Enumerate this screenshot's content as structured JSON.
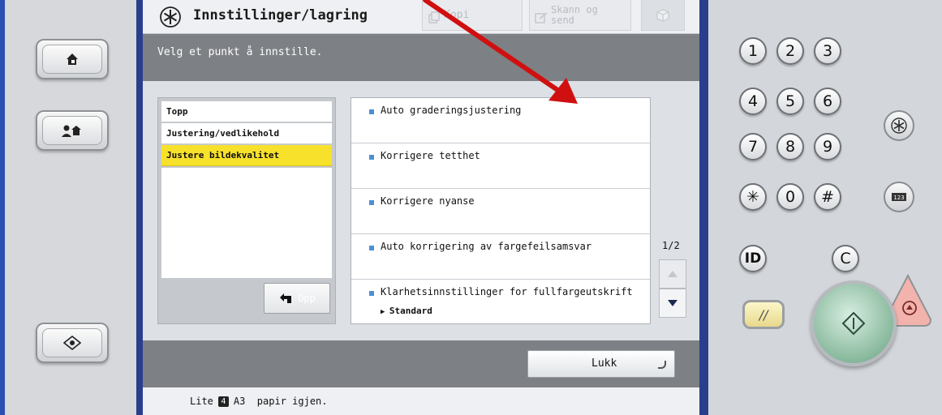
{
  "screen": {
    "title": "Innstillinger/lagring",
    "tabs": [
      {
        "label": "Kopi"
      },
      {
        "label": "Skann og\nsend"
      }
    ],
    "instruction": "Velg et punkt å innstille.",
    "nav": [
      {
        "label": "Topp"
      },
      {
        "label": "Justering/vedlikehold"
      },
      {
        "label": "Justere bildekvalitet"
      }
    ],
    "up_label": "Opp",
    "items": [
      {
        "label": "Auto graderingsjustering"
      },
      {
        "label": "Korrigere tetthet"
      },
      {
        "label": "Korrigere nyanse"
      },
      {
        "label": "Auto korrigering av fargefeilsamsvar"
      },
      {
        "label": "Klarhetsinnstillinger for fullfargeutskrift",
        "value": "Standard"
      }
    ],
    "page_indicator": "1/2",
    "close_label": "Lukk",
    "status": {
      "prefix": "Lite",
      "drawer": "4",
      "suffix": "A3  papir igjen."
    }
  },
  "keypad": {
    "keys": [
      "1",
      "2",
      "3",
      "4",
      "5",
      "6",
      "7",
      "8",
      "9",
      "✳",
      "0",
      "#"
    ],
    "id_label": "ID",
    "clear_label": "C",
    "reset_label": "//"
  },
  "colors": {
    "accent_yellow": "#f7e12a",
    "bar_gray": "#7d8084",
    "bezel_blue": "#2b3e8c",
    "annotation_red": "#d01010"
  }
}
